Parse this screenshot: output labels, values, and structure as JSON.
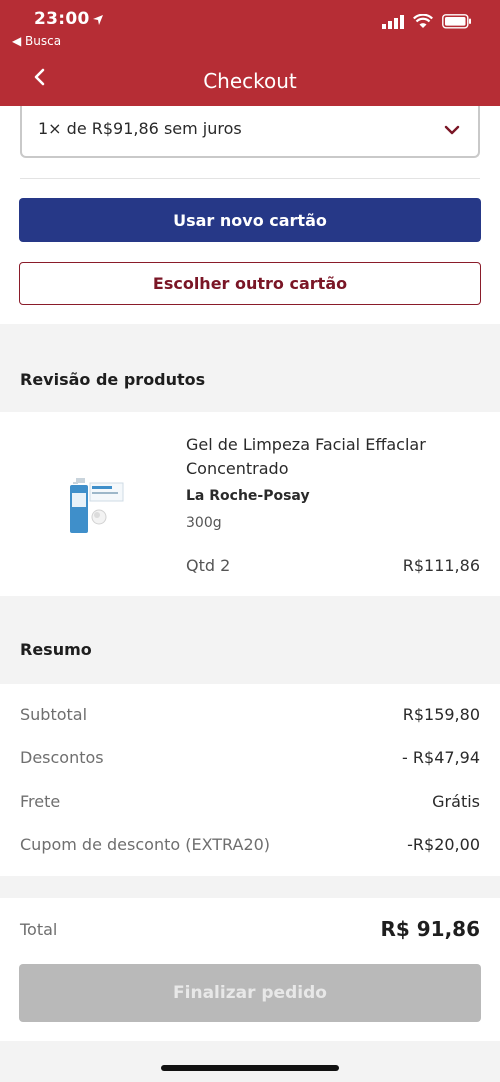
{
  "status_bar": {
    "time": "23:00",
    "back_app": "Busca"
  },
  "header": {
    "title": "Checkout"
  },
  "payment": {
    "installment_selected": "1× de R$91,86 sem juros",
    "use_new_card_label": "Usar novo cartão",
    "choose_other_card_label": "Escolher outro cartão"
  },
  "review": {
    "title": "Revisão de produtos",
    "product": {
      "name": "Gel de Limpeza Facial Effaclar Concentrado",
      "brand": "La Roche-Posay",
      "size": "300g",
      "qty": "Qtd 2",
      "price": "R$111,86"
    }
  },
  "summary": {
    "title": "Resumo",
    "rows": [
      {
        "label": "Subtotal",
        "value": "R$159,80"
      },
      {
        "label": "Descontos",
        "value": "- R$47,94"
      },
      {
        "label": "Frete",
        "value": "Grátis"
      },
      {
        "label": "Cupom de desconto (EXTRA20)",
        "value": "-R$20,00"
      }
    ]
  },
  "total": {
    "label": "Total",
    "value": "R$ 91,86"
  },
  "finalize_label": "Finalizar pedido",
  "colors": {
    "header": "#b62d35",
    "primary_button": "#263887",
    "outline_button": "#8a1c2a",
    "disabled_button": "#b9b9b9"
  },
  "icons": {
    "back": "chevron-left-icon",
    "select": "chevron-down-icon",
    "signal": "signal-icon",
    "wifi": "wifi-icon",
    "battery": "battery-icon",
    "location": "location-arrow-icon"
  }
}
